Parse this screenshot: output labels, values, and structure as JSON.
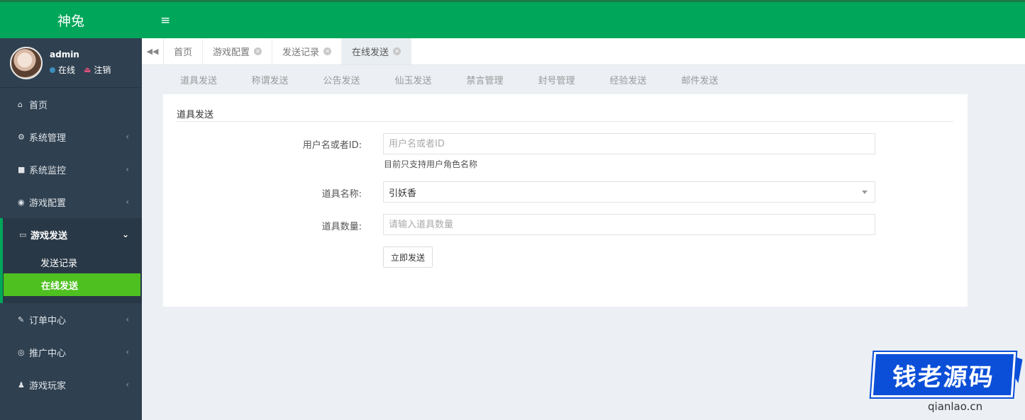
{
  "brand": {
    "title": "神兔"
  },
  "user": {
    "name": "admin",
    "status": "在线",
    "logout": "注销"
  },
  "sidebar": {
    "items": [
      {
        "label": "首页",
        "icon": "home-icon",
        "glyph": "⌂"
      },
      {
        "label": "系统管理",
        "icon": "gear-icon",
        "glyph": "⚙"
      },
      {
        "label": "系统监控",
        "icon": "video-camera-icon",
        "glyph": "■"
      },
      {
        "label": "游戏配置",
        "icon": "gamepad-icon",
        "glyph": "◉"
      },
      {
        "label": "游戏发送",
        "icon": "keyboard-icon",
        "glyph": "▭"
      },
      {
        "label": "订单中心",
        "icon": "pen-icon",
        "glyph": "✎"
      },
      {
        "label": "推广中心",
        "icon": "eye-icon",
        "glyph": "◎"
      },
      {
        "label": "游戏玩家",
        "icon": "user-icon",
        "glyph": "♟"
      }
    ],
    "sub_items": [
      {
        "label": "发送记录"
      },
      {
        "label": "在线发送"
      }
    ]
  },
  "topbar": {
    "menu_icon": "hamburger-icon",
    "glyph": "≡"
  },
  "tabs": [
    {
      "label": "首页",
      "closable": false
    },
    {
      "label": "游戏配置",
      "closable": true
    },
    {
      "label": "发送记录",
      "closable": true
    },
    {
      "label": "在线发送",
      "closable": true,
      "active": true
    }
  ],
  "subnav": [
    "道具发送",
    "称谓发送",
    "公告发送",
    "仙玉发送",
    "禁言管理",
    "封号管理",
    "经验发送",
    "邮件发送"
  ],
  "form": {
    "title": "道具发送",
    "user_label": "用户名或者ID:",
    "user_placeholder": "用户名或者ID",
    "user_help": "目前只支持用户角色名称",
    "item_label": "道具名称:",
    "item_value": "引妖香",
    "qty_label": "道具数量:",
    "qty_placeholder": "请输入道具数量",
    "submit_label": "立即发送"
  },
  "watermark": {
    "text": "钱老源码",
    "url": "qianlao.cn"
  },
  "colors": {
    "accent": "#00a65a",
    "sidebar": "#2f4050",
    "active_sub": "#4ec121"
  }
}
